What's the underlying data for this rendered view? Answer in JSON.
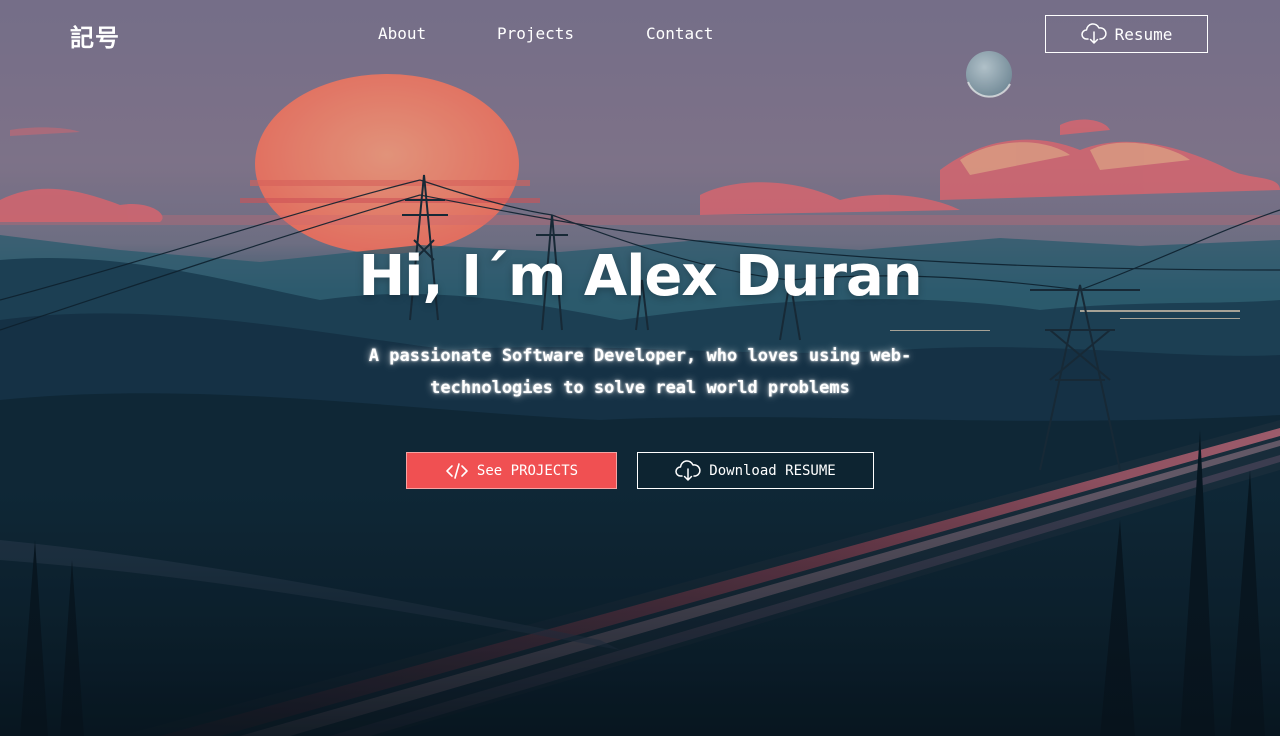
{
  "nav": {
    "logo": "記号",
    "links": [
      {
        "label": "About"
      },
      {
        "label": "Projects"
      },
      {
        "label": "Contact"
      }
    ],
    "resume_button": {
      "label": "Resume",
      "icon": "cloud-download-icon"
    }
  },
  "hero": {
    "title": "Hi, I´m Alex Duran",
    "subtitle": "A passionate Software Developer, who loves using web-technologies to solve real world problems",
    "buttons": {
      "projects": {
        "label": "See PROJECTS",
        "icon": "code-icon"
      },
      "resume": {
        "label": "Download RESUME",
        "icon": "cloud-download-icon"
      }
    }
  },
  "colors": {
    "accent": "#f05052",
    "text": "#ffffff",
    "sky": "#8c7f9a",
    "sun": "#ff8f78",
    "ground": "#0b1b26"
  }
}
